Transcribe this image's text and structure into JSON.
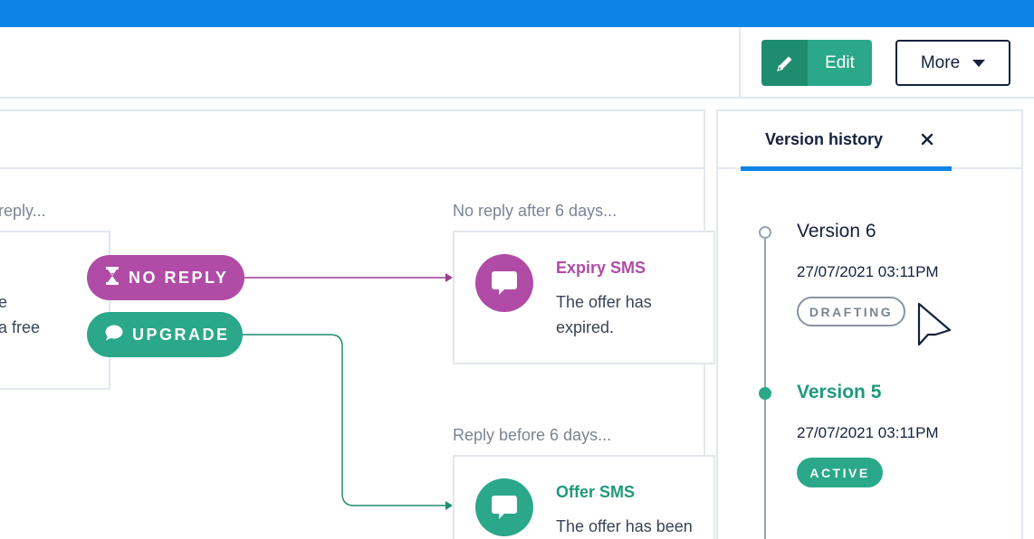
{
  "colors": {
    "brand_blue": "#0a84e6",
    "green": "#2aa889",
    "green_dark": "#1f8c70",
    "purple": "#b04ba6",
    "navy": "#14213d",
    "muted": "#7a8494"
  },
  "header": {
    "edit_label": "Edit",
    "edit_icon": "pencil-icon",
    "more_label": "More",
    "more_icon": "caret-down-icon"
  },
  "flow": {
    "left_node": {
      "label": "reply...",
      "text_line1": "e",
      "text_line2": "a free"
    },
    "branches": {
      "no_reply": {
        "label": "NO REPLY",
        "icon": "hourglass-icon"
      },
      "upgrade": {
        "label": "UPGRADE",
        "icon": "chat-bubble-icon"
      }
    },
    "expiry": {
      "label": "No reply after 6 days...",
      "title": "Expiry SMS",
      "text_line1": "The offer has",
      "text_line2": "expired.",
      "icon": "message-icon"
    },
    "offer": {
      "label": "Reply before 6 days...",
      "title": "Offer SMS",
      "text_line1": "The offer has been",
      "icon": "message-icon"
    }
  },
  "version_history": {
    "tab_label": "Version history",
    "close_icon": "close-icon",
    "versions": [
      {
        "title": "Version 6",
        "date": "27/07/2021 03:11PM",
        "status": "DRAFTING"
      },
      {
        "title": "Version 5",
        "date": "27/07/2021 03:11PM",
        "status": "ACTIVE"
      }
    ]
  }
}
